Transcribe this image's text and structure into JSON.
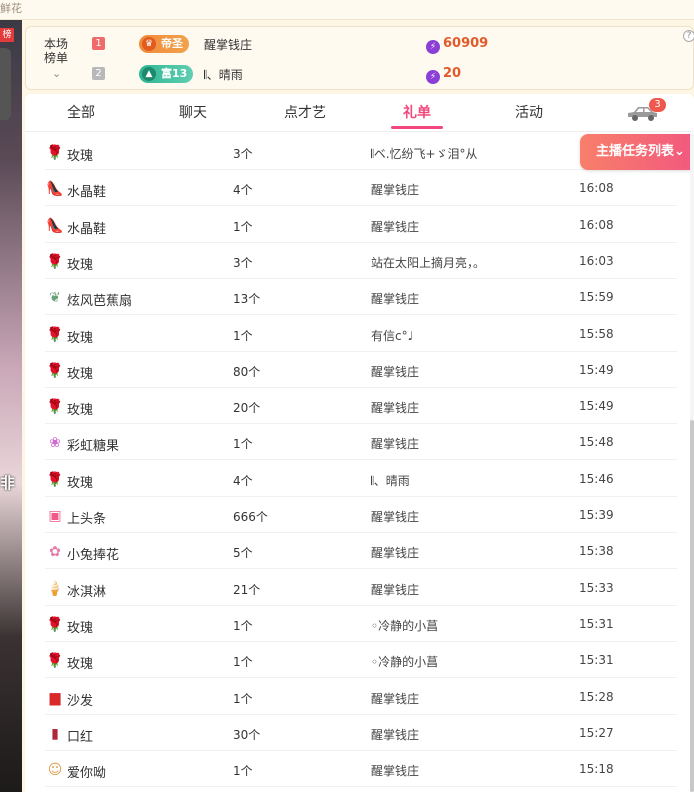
{
  "top_strip": {
    "text": "鲜花"
  },
  "left_thumb": {
    "badge": "榜",
    "text": "非"
  },
  "rank": {
    "label": "本场榜单",
    "help": "?",
    "rows": [
      {
        "num": "1",
        "badge": "帝圣",
        "name": "醒掌钱庄",
        "score": "60909"
      },
      {
        "num": "2",
        "badge": "富13",
        "name": "𝄃、晴雨",
        "score": "20"
      }
    ]
  },
  "tabs": {
    "items": [
      {
        "label": "全部"
      },
      {
        "label": "聊天"
      },
      {
        "label": "点才艺"
      },
      {
        "label": "礼单"
      },
      {
        "label": "活动"
      }
    ],
    "active": "礼单",
    "car_badge": "3"
  },
  "task_button": {
    "label": "主播任务列表⌄"
  },
  "gifts": [
    {
      "icon": "rose-icon",
      "name": "玫瑰",
      "count": "3个",
      "user": "𝄃ベ.忆纷飞+ゞ泪°从",
      "time": ""
    },
    {
      "icon": "crystal-shoe-icon",
      "name": "水晶鞋",
      "count": "4个",
      "user": "醒掌钱庄",
      "time": "16:08"
    },
    {
      "icon": "crystal-shoe-icon",
      "name": "水晶鞋",
      "count": "1个",
      "user": "醒掌钱庄",
      "time": "16:08"
    },
    {
      "icon": "rose-icon",
      "name": "玫瑰",
      "count": "3个",
      "user": "站在太阳上摘月亮，。",
      "time": "16:03"
    },
    {
      "icon": "fan-icon",
      "name": "炫风芭蕉扇",
      "count": "13个",
      "user": "醒掌钱庄",
      "time": "15:59"
    },
    {
      "icon": "rose-icon",
      "name": "玫瑰",
      "count": "1个",
      "user": "有信c°♩",
      "time": "15:58"
    },
    {
      "icon": "rose-icon",
      "name": "玫瑰",
      "count": "80个",
      "user": "醒掌钱庄",
      "time": "15:49"
    },
    {
      "icon": "rose-icon",
      "name": "玫瑰",
      "count": "20个",
      "user": "醒掌钱庄",
      "time": "15:49"
    },
    {
      "icon": "rainbow-candy-icon",
      "name": "彩虹糖果",
      "count": "1个",
      "user": "醒掌钱庄",
      "time": "15:48"
    },
    {
      "icon": "rose-icon",
      "name": "玫瑰",
      "count": "4个",
      "user": "𝄃、晴雨",
      "time": "15:46"
    },
    {
      "icon": "headline-icon",
      "name": "上头条",
      "count": "666个",
      "user": "醒掌钱庄",
      "time": "15:39"
    },
    {
      "icon": "bunny-bouquet-icon",
      "name": "小兔捧花",
      "count": "5个",
      "user": "醒掌钱庄",
      "time": "15:38"
    },
    {
      "icon": "ice-cream-icon",
      "name": "冰淇淋",
      "count": "21个",
      "user": "醒掌钱庄",
      "time": "15:33"
    },
    {
      "icon": "rose-icon",
      "name": "玫瑰",
      "count": "1个",
      "user": "◦冷静的小菖",
      "time": "15:31"
    },
    {
      "icon": "rose-icon",
      "name": "玫瑰",
      "count": "1个",
      "user": "◦冷静的小菖",
      "time": "15:31"
    },
    {
      "icon": "sofa-icon",
      "name": "沙发",
      "count": "1个",
      "user": "醒掌钱庄",
      "time": "15:28"
    },
    {
      "icon": "lipstick-icon",
      "name": "口红",
      "count": "30个",
      "user": "醒掌钱庄",
      "time": "15:27"
    },
    {
      "icon": "love-you-icon",
      "name": "爱你呦",
      "count": "1个",
      "user": "醒掌钱庄",
      "time": "15:18"
    }
  ]
}
